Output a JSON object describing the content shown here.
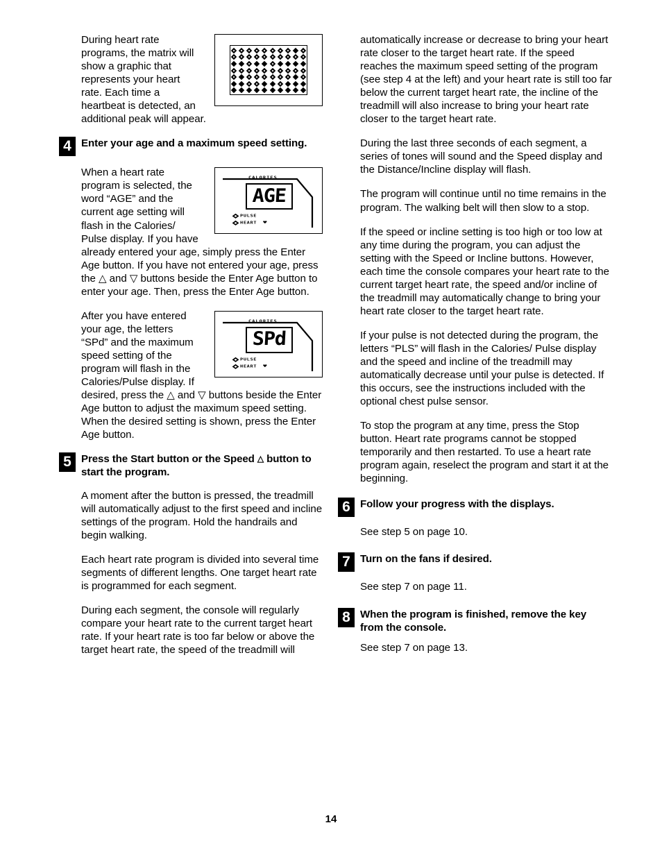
{
  "page": {
    "number": "14"
  },
  "left_column": {
    "intro_paragraph": "During heart rate programs, the matrix will show a graphic that represents your heart rate. Each time a heartbeat is detected, an additional peak will appear.",
    "matrix_figure": {
      "name": "dot-matrix-display",
      "rows": 7,
      "columns": 10
    },
    "step4": {
      "number": "4",
      "title": "Enter your age and a maximum speed setting.",
      "paragraph1": "When a heart rate program is selected, the word “AGE” and the current age setting will flash in the Calories/ Pulse display. If you have already entered your age, simply press the Enter Age button. If you have not entered your age, press the △ and ▽ buttons beside the Enter Age button to enter your age. Then, press the Enter Age button.",
      "figure1": {
        "name": "age-display",
        "segment_text": "AGE",
        "top_label": "CALORIES",
        "indicator_row1": "PULSE",
        "indicator_row2": "HEART",
        "heart_icon": "heart-icon"
      },
      "paragraph2": "After you have entered your age, the letters “SPd” and the maximum speed setting of the program will flash in the Calories/Pulse display. If desired, press the △ and ▽ buttons beside the Enter Age button to adjust the maximum speed setting. When the desired setting is shown, press the Enter Age button.",
      "figure2": {
        "name": "speed-display",
        "segment_text": "SPd",
        "top_label": "CALORIES",
        "indicator_row1": "PULSE",
        "indicator_row2": "HEART",
        "heart_icon": "heart-icon"
      }
    },
    "step5": {
      "number": "5",
      "title_part1": "Press the Start button or the Speed ",
      "title_symbol": "△",
      "title_part2": " button to start the program.",
      "paragraph1": "A moment after the button is pressed, the treadmill will automatically adjust to the first speed and incline settings of the program. Hold the handrails and begin walking.",
      "paragraph2": "Each heart rate program is divided into several time segments of different lengths. One target heart rate is programmed for each segment.",
      "paragraph3": "During each segment, the console will regularly compare your heart rate to the current target heart rate. If your heart rate is too far below or above the target heart rate, the speed of the treadmill will"
    }
  },
  "right_column": {
    "paragraph1": "automatically increase or decrease to bring your heart rate closer to the target heart rate. If the speed reaches the maximum speed setting of the program (see step 4 at the left) and your heart rate is still too far below the current target heart rate, the incline of the treadmill will also increase to bring your heart rate closer to the target heart rate.",
    "paragraph2": "During the last three seconds of each segment, a series of tones will sound and the Speed display and the Distance/Incline display will flash.",
    "paragraph3": "The program will continue until no time remains in the program. The walking belt will then slow to a stop.",
    "paragraph4": "If the speed or incline setting is too high or too low at any time during the program, you can adjust the setting with the Speed or Incline buttons. However, each time the console compares your heart rate to the current target heart rate, the speed and/or incline of the treadmill may automatically change to bring your heart rate closer to the target heart rate.",
    "paragraph5": "If your pulse is not detected during the program, the letters “PLS” will flash in the Calories/ Pulse display and the speed and incline of the treadmill may automatically decrease until your pulse is detected. If this occurs, see the instructions included with the optional chest pulse sensor.",
    "paragraph6": "To stop the program at any time, press the Stop button. Heart rate programs cannot be stopped temporarily and then restarted. To use a heart rate program again, reselect the program and start it at the beginning.",
    "step6": {
      "number": "6",
      "title": "Follow your progress with the displays.",
      "body": "See step 5 on page 10."
    },
    "step7": {
      "number": "7",
      "title": "Turn on the fans if desired.",
      "body": "See step 7 on page 11."
    },
    "step8": {
      "number": "8",
      "title": "When the program is finished, remove the key from the console.",
      "body": "See step 7 on page 13."
    }
  }
}
